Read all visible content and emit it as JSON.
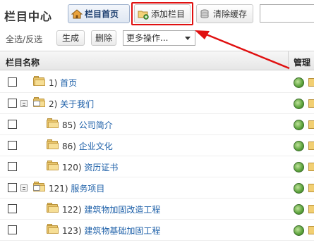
{
  "header": {
    "title": "栏目中心",
    "buttons": {
      "home": "栏目首页",
      "add": "添加栏目",
      "clear": "清除缓存"
    },
    "search_value": ""
  },
  "toolbar": {
    "select_all": "全选",
    "invert": "反选",
    "separator": "/",
    "generate": "生成",
    "delete": "删除",
    "more_actions": "更多操作..."
  },
  "table": {
    "columns": [
      "栏目名称",
      "管理"
    ],
    "rows": [
      {
        "num": "1)",
        "name": "首页",
        "level": 0,
        "expandable": false
      },
      {
        "num": "2)",
        "name": "关于我们",
        "level": 0,
        "expandable": true
      },
      {
        "num": "85)",
        "name": "公司简介",
        "level": 1,
        "expandable": false
      },
      {
        "num": "86)",
        "name": "企业文化",
        "level": 1,
        "expandable": false
      },
      {
        "num": "120)",
        "name": "资历证书",
        "level": 1,
        "expandable": false
      },
      {
        "num": "121)",
        "name": "服务项目",
        "level": 0,
        "expandable": true
      },
      {
        "num": "122)",
        "name": "建筑物加固改造工程",
        "level": 1,
        "expandable": false
      },
      {
        "num": "123)",
        "name": "建筑物基础加固工程",
        "level": 1,
        "expandable": false
      }
    ]
  },
  "annotation": {
    "color": "#e01010"
  }
}
